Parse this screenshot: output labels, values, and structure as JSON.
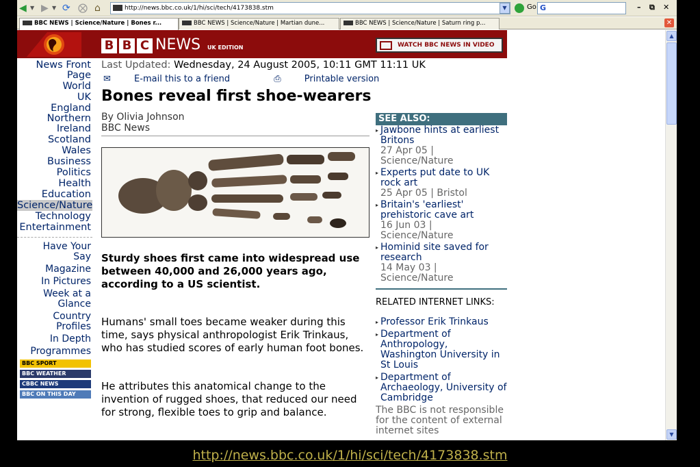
{
  "browser": {
    "url": "http://news.bbc.co.uk/1/hi/sci/tech/4173838.stm",
    "go_label": "Go",
    "search_label": "G",
    "tabs": [
      {
        "label": "BBC NEWS | Science/Nature | Bones r..."
      },
      {
        "label": "BBC NEWS | Science/Nature | Martian dune..."
      },
      {
        "label": "BBC NEWS | Science/Nature | Saturn ring p..."
      }
    ]
  },
  "header": {
    "b1": "B",
    "b2": "B",
    "b3": "C",
    "news": "NEWS",
    "edition": "UK EDITION",
    "watch": "WATCH BBC NEWS IN VIDEO",
    "brand_color": "#8c0c0c"
  },
  "nav": {
    "items": [
      "News Front Page",
      "World",
      "UK",
      "England",
      "Northern Ireland",
      "Scotland",
      "Wales",
      "Business",
      "Politics",
      "Health",
      "Education",
      "Science/Nature",
      "Technology",
      "Entertainment"
    ],
    "selected": "Science/Nature",
    "secondary": [
      "Have Your Say",
      "Magazine",
      "In Pictures",
      "Week at a Glance",
      "Country Profiles",
      "In Depth",
      "Programmes"
    ],
    "promos": [
      "BBC SPORT",
      "BBC WEATHER",
      "CBBC NEWS",
      "BBC ON THIS DAY"
    ]
  },
  "article": {
    "updated_label": "Last Updated:",
    "updated_value": "Wednesday, 24 August 2005, 10:11 GMT 11:11 UK",
    "email": "E-mail this to a friend",
    "print": "Printable version",
    "headline": "Bones reveal first shoe-wearers",
    "author": "By Olivia Johnson",
    "source": "BBC News",
    "lead": "Sturdy shoes first came into widespread use between 40,000 and 26,000 years ago, according to a US scientist.",
    "para1": "Humans' small toes became weaker during this time, says physical anthropologist Erik Trinkaus, who has studied scores of early human foot bones.",
    "para2": "He attributes this anatomical change to the invention of rugged shoes, that reduced our need for strong, flexible toes to grip and balance."
  },
  "see_also": {
    "title": "SEE ALSO:",
    "items": [
      {
        "link": "Jawbone hints at earliest Britons",
        "meta": "27 Apr 05 |  Science/Nature"
      },
      {
        "link": "Experts put date to UK rock art",
        "meta": "25 Apr 05 |  Bristol"
      },
      {
        "link": "Britain's 'earliest' prehistoric cave art",
        "meta": "16 Jun 03 |  Science/Nature"
      },
      {
        "link": "Hominid site saved for research",
        "meta": "14 May 03 |  Science/Nature"
      }
    ]
  },
  "related": {
    "title": "RELATED INTERNET LINKS:",
    "items": [
      "Professor Erik Trinkaus",
      "Department of Anthropology, Washington University in St Louis",
      "Department of Archaeology, University of Cambridge"
    ],
    "disclaimer": "The BBC is not responsible for the content of external internet sites"
  },
  "caption": "http://news.bbc.co.uk/1/hi/sci/tech/4173838.stm"
}
